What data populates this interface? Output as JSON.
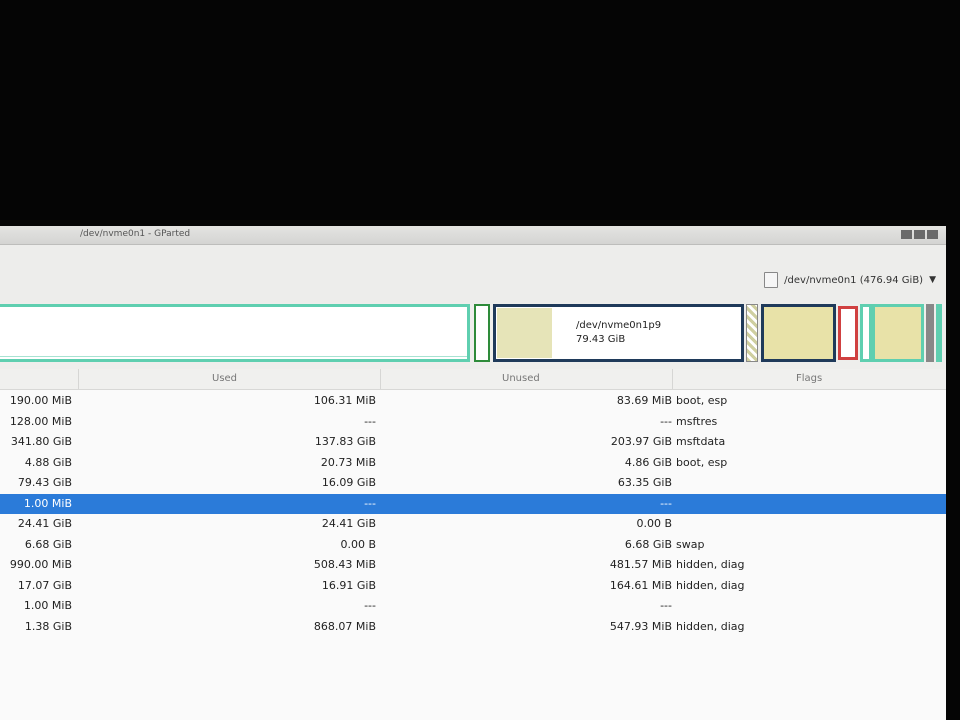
{
  "window": {
    "title": "/dev/nvme0n1 - GParted"
  },
  "device": {
    "label": "/dev/nvme0n1 (476.94 GiB)"
  },
  "selected_partition": {
    "name": "/dev/nvme0n1p9",
    "size": "79.43 GiB"
  },
  "columns": {
    "used": "Used",
    "unused": "Unused",
    "flags": "Flags"
  },
  "rows": [
    {
      "size": "190.00 MiB",
      "used": "106.31 MiB",
      "unused": "83.69 MiB",
      "flags": "boot, esp"
    },
    {
      "size": "128.00 MiB",
      "used": "---",
      "unused": "---",
      "flags": "msftres"
    },
    {
      "size": "341.80 GiB",
      "used": "137.83 GiB",
      "unused": "203.97 GiB",
      "flags": "msftdata"
    },
    {
      "size": "4.88 GiB",
      "used": "20.73 MiB",
      "unused": "4.86 GiB",
      "flags": "boot, esp"
    },
    {
      "size": "79.43 GiB",
      "used": "16.09 GiB",
      "unused": "63.35 GiB",
      "flags": ""
    },
    {
      "size": "1.00 MiB",
      "used": "---",
      "unused": "---",
      "flags": ""
    },
    {
      "size": "24.41 GiB",
      "used": "24.41 GiB",
      "unused": "0.00 B",
      "flags": ""
    },
    {
      "size": "6.68 GiB",
      "used": "0.00 B",
      "unused": "6.68 GiB",
      "flags": "swap"
    },
    {
      "size": "990.00 MiB",
      "used": "508.43 MiB",
      "unused": "481.57 MiB",
      "flags": "hidden, diag"
    },
    {
      "size": "17.07 GiB",
      "used": "16.91 GiB",
      "unused": "164.61 MiB",
      "flags": "hidden, diag"
    },
    {
      "size": "1.00 MiB",
      "used": "---",
      "unused": "---",
      "flags": ""
    },
    {
      "size": "1.38 GiB",
      "used": "868.07 MiB",
      "unused": "547.93 MiB",
      "flags": "hidden, diag"
    }
  ],
  "selected_row": 5
}
